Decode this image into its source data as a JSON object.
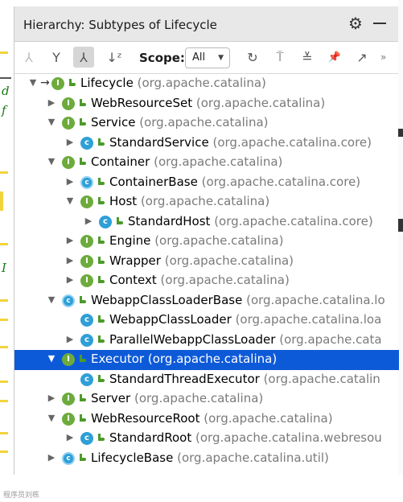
{
  "window": {
    "title": "Hierarchy: Subtypes of Lifecycle",
    "icons": {
      "settings": "gear-icon",
      "minimize": "minimize-icon"
    }
  },
  "toolbar": {
    "buttons": [
      {
        "name": "type-hierarchy-button",
        "icon": "type-hierarchy-icon",
        "glyph": "⅄",
        "state": "disabled"
      },
      {
        "name": "supertypes-hierarchy-button",
        "icon": "supertypes-icon",
        "glyph": "Y",
        "state": "normal"
      },
      {
        "name": "subtypes-hierarchy-button",
        "icon": "subtypes-icon",
        "glyph": "⅄",
        "state": "pressed"
      },
      {
        "name": "sort-alphabetically-button",
        "icon": "sort-az-icon",
        "glyph": "↓ᶻ",
        "state": "normal"
      }
    ],
    "scope_label": "Scope:",
    "scope_value": "All",
    "right_buttons": [
      {
        "name": "refresh-button",
        "icon": "refresh-icon",
        "glyph": "↻"
      },
      {
        "name": "autoscroll-to-source-button",
        "icon": "autoscroll-icon",
        "glyph": "⍑"
      },
      {
        "name": "collapse-all-button",
        "icon": "collapse-all-icon",
        "glyph": "≚"
      },
      {
        "name": "pin-button",
        "icon": "pin-icon",
        "glyph": "📌"
      },
      {
        "name": "open-in-tab-button",
        "icon": "open-in-new-tab-icon",
        "glyph": "↗"
      }
    ],
    "more": "»"
  },
  "tree": [
    {
      "level": 0,
      "arrow": "down",
      "kind": "I",
      "focus": true,
      "name": "Lifecycle",
      "pkg": "(org.apache.catalina)"
    },
    {
      "level": 1,
      "arrow": "right",
      "kind": "I",
      "name": "WebResourceSet",
      "pkg": "(org.apache.catalina)"
    },
    {
      "level": 1,
      "arrow": "down",
      "kind": "I",
      "name": "Service",
      "pkg": "(org.apache.catalina)"
    },
    {
      "level": 2,
      "arrow": "right",
      "kind": "C",
      "name": "StandardService",
      "pkg": "(org.apache.catalina.core)"
    },
    {
      "level": 1,
      "arrow": "down",
      "kind": "I",
      "name": "Container",
      "pkg": "(org.apache.catalina)"
    },
    {
      "level": 2,
      "arrow": "right",
      "kind": "A",
      "name": "ContainerBase",
      "pkg": "(org.apache.catalina.core)"
    },
    {
      "level": 2,
      "arrow": "down",
      "kind": "I",
      "name": "Host",
      "pkg": "(org.apache.catalina)"
    },
    {
      "level": 3,
      "arrow": "right",
      "kind": "C",
      "name": "StandardHost",
      "pkg": "(org.apache.catalina.core)"
    },
    {
      "level": 2,
      "arrow": "right",
      "kind": "I",
      "name": "Engine",
      "pkg": "(org.apache.catalina)"
    },
    {
      "level": 2,
      "arrow": "right",
      "kind": "I",
      "name": "Wrapper",
      "pkg": "(org.apache.catalina)"
    },
    {
      "level": 2,
      "arrow": "right",
      "kind": "I",
      "name": "Context",
      "pkg": "(org.apache.catalina)"
    },
    {
      "level": 1,
      "arrow": "down",
      "kind": "A",
      "name": "WebappClassLoaderBase",
      "pkg": "(org.apache.catalina.lo"
    },
    {
      "level": 2,
      "arrow": "none",
      "kind": "C",
      "name": "WebappClassLoader",
      "pkg": "(org.apache.catalina.loa"
    },
    {
      "level": 2,
      "arrow": "right",
      "kind": "C",
      "name": "ParallelWebappClassLoader",
      "pkg": "(org.apache.cata"
    },
    {
      "level": 1,
      "arrow": "down",
      "kind": "I",
      "selected": true,
      "name": "Executor",
      "pkg": "(org.apache.catalina)"
    },
    {
      "level": 2,
      "arrow": "none",
      "kind": "C",
      "name": "StandardThreadExecutor",
      "pkg": "(org.apache.catalin"
    },
    {
      "level": 1,
      "arrow": "right",
      "kind": "I",
      "name": "Server",
      "pkg": "(org.apache.catalina)"
    },
    {
      "level": 1,
      "arrow": "down",
      "kind": "I",
      "name": "WebResourceRoot",
      "pkg": "(org.apache.catalina)"
    },
    {
      "level": 2,
      "arrow": "right",
      "kind": "C",
      "name": "StandardRoot",
      "pkg": "(org.apache.catalina.webresou"
    },
    {
      "level": 1,
      "arrow": "right",
      "kind": "A",
      "name": "LifecycleBase",
      "pkg": "(org.apache.catalina.util)"
    }
  ],
  "editor_gutter": {
    "glyphs": [
      "d",
      "f",
      "I"
    ]
  },
  "footer": "程序员刘栋"
}
